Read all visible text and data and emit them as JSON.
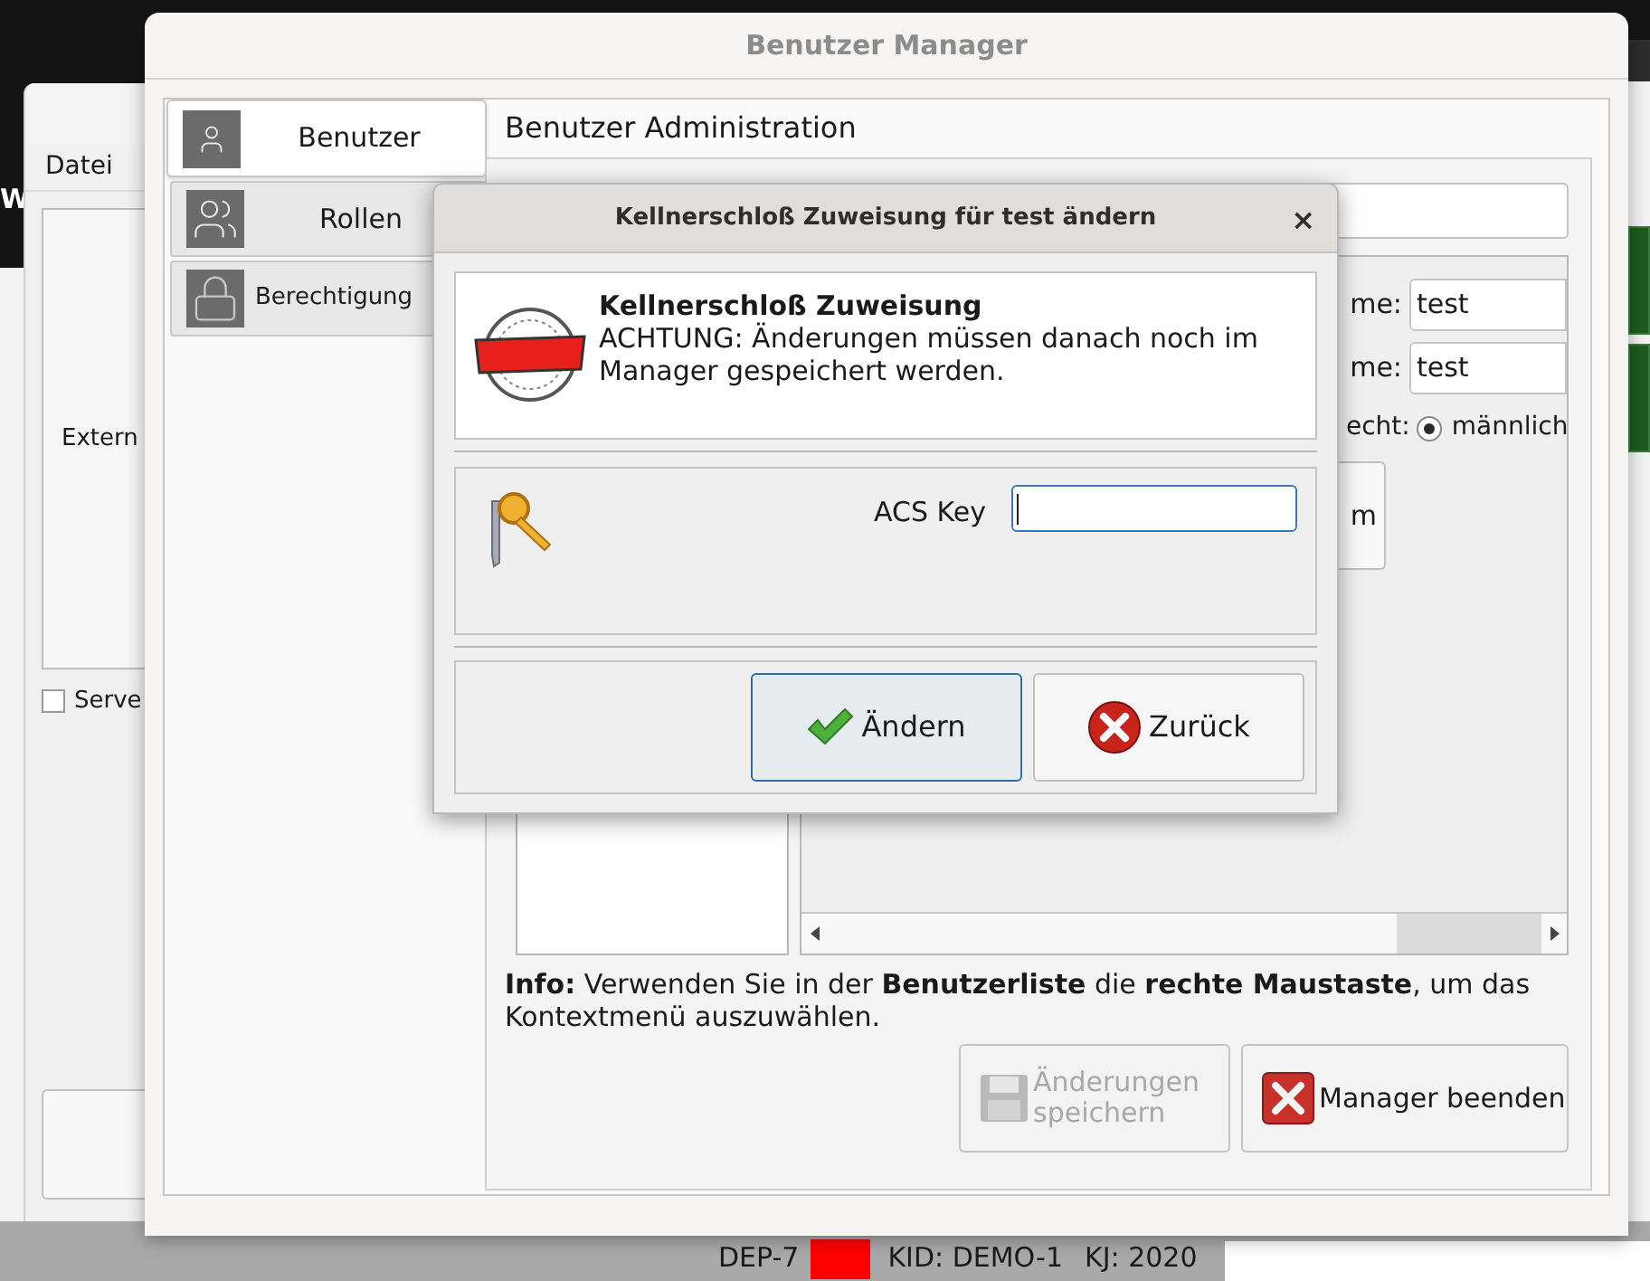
{
  "background_window": {
    "side_letter": "W",
    "menu": [
      "Datei"
    ],
    "group_label": "Extern",
    "checkbox": {
      "label": "Serve",
      "checked": false
    }
  },
  "main_window": {
    "title": "Benutzer Manager",
    "tabs": [
      {
        "label": "Benutzer",
        "selected": true,
        "kind": "user"
      },
      {
        "label": "Rollen",
        "selected": false,
        "kind": "group"
      },
      {
        "label": "Berechtigung",
        "selected": false,
        "kind": "lock"
      }
    ],
    "section_title": "Benutzer Administration",
    "form_fields": [
      {
        "label": "me:",
        "value": "test"
      },
      {
        "label": "me:",
        "value": "test"
      }
    ],
    "gender": {
      "label": "echt:",
      "option": "männlich",
      "selected": true
    },
    "partial_button": "m",
    "info": "**Info:** Verwenden Sie in der **Benutzerliste** die **rechte Maustaste**, um das Kontextmenü auszuwählen.",
    "buttons": [
      {
        "label": "Änderungen speichern",
        "disabled": true,
        "kind": "save"
      },
      {
        "label": "Manager beenden",
        "disabled": false,
        "kind": "close"
      }
    ]
  },
  "dialog": {
    "title": "Kellnerschloß Zuweisung für test ändern",
    "close": "×",
    "heading": "Kellnerschloß Zuweisung",
    "message": "ACHTUNG: Änderungen müssen danach noch im Manager gespeichert werden.",
    "field_label": "ACS Key",
    "buttons": [
      {
        "label": "Ändern",
        "kind": "check",
        "focused": true
      },
      {
        "label": "Zurück",
        "kind": "cancel",
        "focused": false
      }
    ]
  },
  "status_bar": {
    "items": [
      "DEP-7",
      "KID: DEMO-1",
      "KJ: 2020"
    ]
  }
}
